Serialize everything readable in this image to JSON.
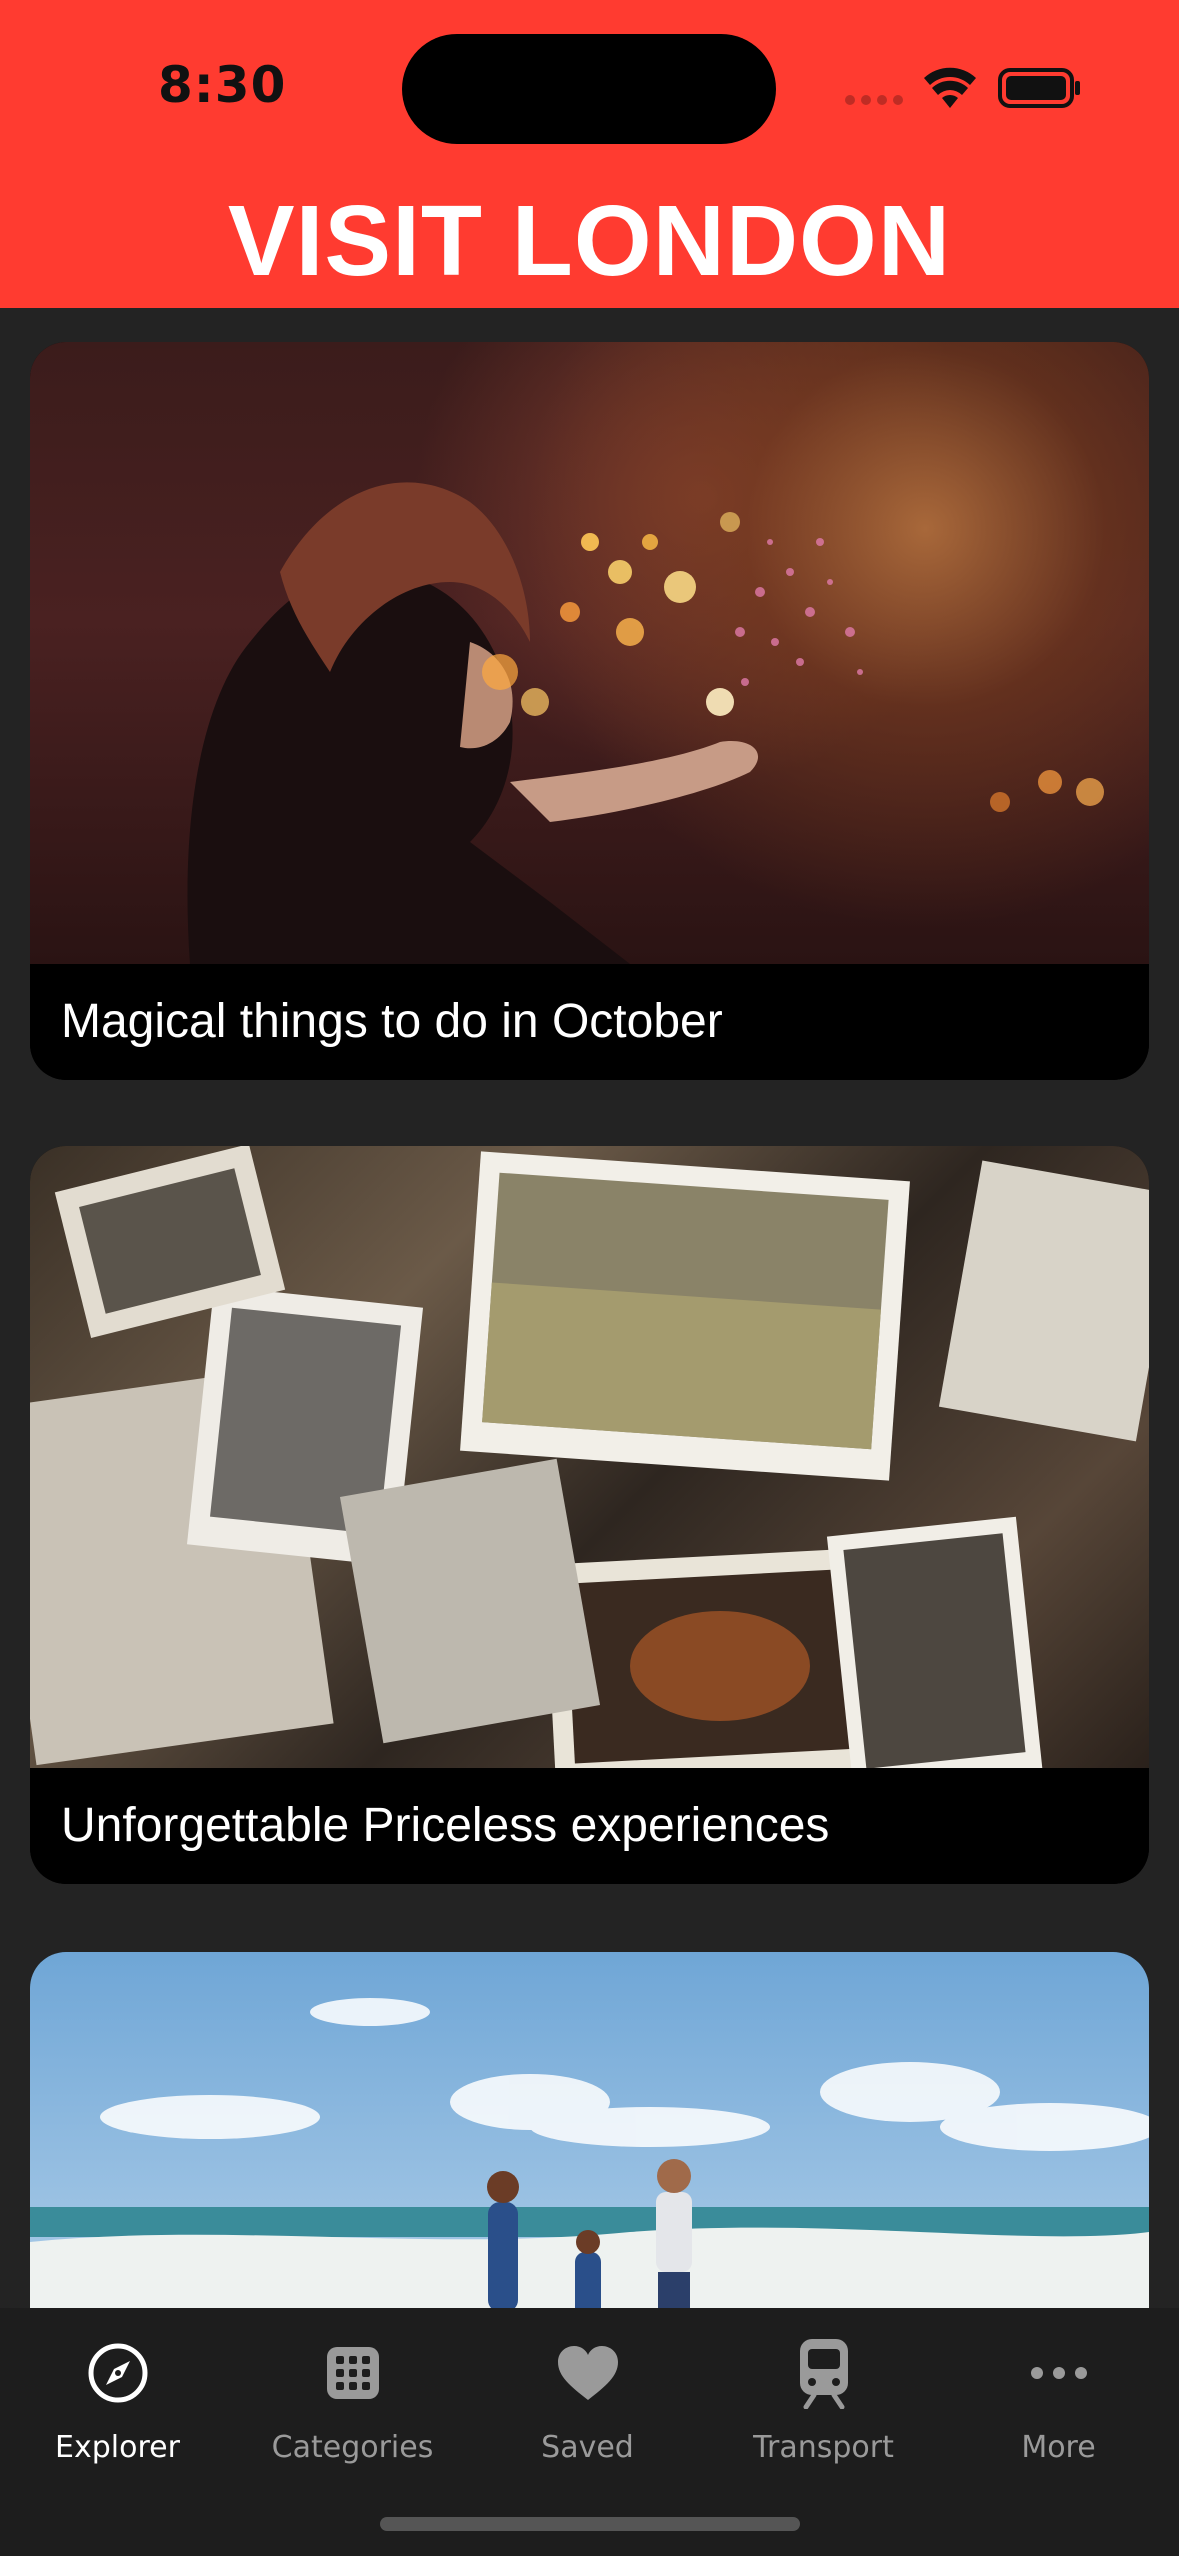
{
  "status_bar": {
    "time": "8:30"
  },
  "header": {
    "title": "VISIT LONDON",
    "background_color": "#ff3b30"
  },
  "feed": {
    "cards": [
      {
        "caption": "Magical things to do in October",
        "image": "woman-blowing-sparkles-photo"
      },
      {
        "caption": "Unforgettable Priceless experiences",
        "image": "vintage-photographs-pile-photo"
      },
      {
        "caption": "",
        "image": "family-at-beach-photo"
      }
    ]
  },
  "tab_bar": {
    "active_tab": "Explorer",
    "tabs": [
      {
        "label": "Explorer",
        "icon": "compass-icon"
      },
      {
        "label": "Categories",
        "icon": "grid-icon"
      },
      {
        "label": "Saved",
        "icon": "heart-icon"
      },
      {
        "label": "Transport",
        "icon": "train-icon"
      },
      {
        "label": "More",
        "icon": "ellipsis-icon"
      }
    ]
  }
}
